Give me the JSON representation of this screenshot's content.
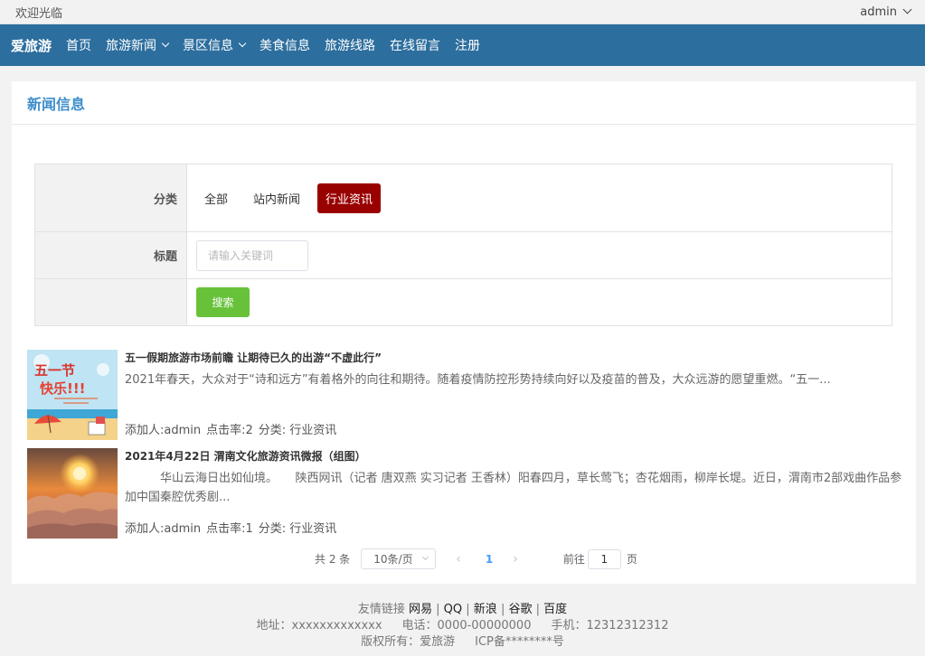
{
  "topbar": {
    "welcome": "欢迎光临",
    "user": "admin"
  },
  "nav": {
    "brand": "爱旅游",
    "items": [
      {
        "label": "首页",
        "dropdown": false
      },
      {
        "label": "旅游新闻",
        "dropdown": true
      },
      {
        "label": "景区信息",
        "dropdown": true
      },
      {
        "label": "美食信息",
        "dropdown": false
      },
      {
        "label": "旅游线路",
        "dropdown": false
      },
      {
        "label": "在线留言",
        "dropdown": false
      },
      {
        "label": "注册",
        "dropdown": false
      }
    ]
  },
  "panel": {
    "title": "新闻信息"
  },
  "filter": {
    "category_label": "分类",
    "categories": [
      "全部",
      "站内新闻",
      "行业资讯"
    ],
    "active_category": "行业资讯",
    "title_label": "标题",
    "title_placeholder": "请输入关键词",
    "title_value": "",
    "search_button": "搜索"
  },
  "news": [
    {
      "title": "五一假期旅游市场前瞻 让期待已久的出游“不虚此行”",
      "summary": "2021年春天，大众对于“诗和远方”有着格外的向往和期待。随着疫情防控形势持续向好以及疫苗的普及，大众远游的愿望重燃。“五一...",
      "author": "添加人:admin",
      "clicks": "点击率:2",
      "category": "分类: 行业资讯",
      "image": "五一节快乐 poster"
    },
    {
      "title": "2021年4月22日 渭南文化旅游资讯微报（组图）",
      "summary": "　　　华山云海日出如仙境。　　陕西网讯（记者 唐双燕 实习记者 王香林）阳春四月，草长莺飞；杏花烟雨，柳岸长堤。近日，渭南市2部戏曲作品参加中国秦腔优秀剧...",
      "author": "添加人:admin",
      "clicks": "点击率:1",
      "category": "分类: 行业资讯",
      "image": "sunrise over sea of clouds"
    }
  ],
  "pagination": {
    "total": "共 2 条",
    "page_size": "10条/页",
    "prev": "‹",
    "current": "1",
    "next": "›",
    "goto_label": "前往",
    "goto_value": "1",
    "goto_suffix": "页"
  },
  "footer": {
    "links_label": "友情链接",
    "links": [
      "网易",
      "QQ",
      "新浪",
      "谷歌",
      "百度"
    ],
    "address": "地址：xxxxxxxxxxxxx",
    "phone": "电话：0000-00000000",
    "mobile": "手机：12312312312",
    "copyright": "版权所有：爱旅游",
    "icp": "ICP备********号"
  },
  "colors": {
    "nav_bg": "#2c6e9e",
    "title": "#3c8dcb",
    "active_category": "#990000",
    "search_button": "#67c23a",
    "pager_active": "#409eff"
  }
}
